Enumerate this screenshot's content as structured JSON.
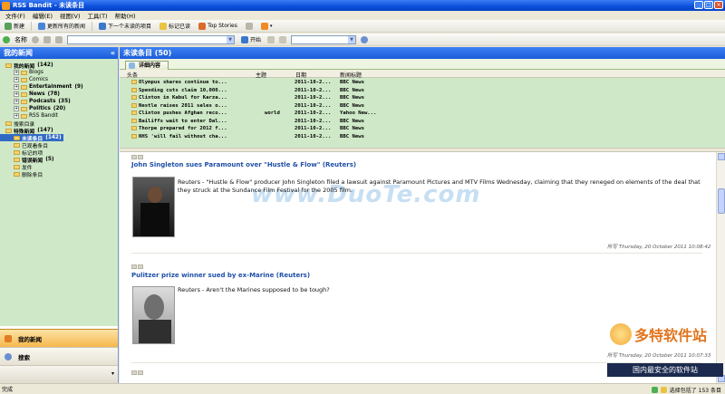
{
  "window": {
    "title": "RSS Bandit - 未读条目"
  },
  "menu": [
    "文件(F)",
    "编辑(E)",
    "视图(V)",
    "工具(T)",
    "帮助(H)"
  ],
  "toolbar1": {
    "new": "新建",
    "refresh_all": "更新所有的新闻",
    "next_unread": "下一个未读的项目",
    "mark_read": "标记已读",
    "top_stories": "Top Stories"
  },
  "toolbar2": {
    "name": "名称",
    "start": "开始"
  },
  "left_pane": {
    "title": "我的新闻",
    "tree": [
      {
        "label": "我的新闻",
        "count": "(142)",
        "bold": true,
        "indent": 1
      },
      {
        "label": "Blogs",
        "count": "",
        "bold": false,
        "indent": 2
      },
      {
        "label": "Comics",
        "count": "",
        "bold": false,
        "indent": 2
      },
      {
        "label": "Entertainment",
        "count": "(9)",
        "bold": true,
        "indent": 2
      },
      {
        "label": "News",
        "count": "(78)",
        "bold": true,
        "indent": 2
      },
      {
        "label": "Podcasts",
        "count": "(35)",
        "bold": true,
        "indent": 2
      },
      {
        "label": "Politics",
        "count": "(20)",
        "bold": true,
        "indent": 2
      },
      {
        "label": "RSS Bandit",
        "count": "",
        "bold": false,
        "indent": 2
      },
      {
        "label": "搜索目录",
        "count": "",
        "bold": false,
        "indent": 1
      },
      {
        "label": "特殊新闻",
        "count": "(147)",
        "bold": true,
        "indent": 1
      },
      {
        "label": "未读条目",
        "count": "(142)",
        "bold": true,
        "indent": 2,
        "selected": true
      },
      {
        "label": "已观看条目",
        "count": "",
        "bold": false,
        "indent": 2
      },
      {
        "label": "标记的项",
        "count": "",
        "bold": false,
        "indent": 2
      },
      {
        "label": "错误新闻",
        "count": "(5)",
        "bold": true,
        "indent": 2
      },
      {
        "label": "发件",
        "count": "",
        "bold": false,
        "indent": 2
      },
      {
        "label": "删除条目",
        "count": "",
        "bold": false,
        "indent": 2
      }
    ],
    "nav_active": "我的新闻",
    "nav_other": "搜索"
  },
  "right_pane": {
    "title": "未读条目 (50)",
    "tab": "详细内容",
    "columns": {
      "headline": "头条",
      "subject": "主题",
      "date": "日期",
      "feed": "新闻标题"
    },
    "rows": [
      {
        "headline": "Olympus shares continue to...",
        "subject": "",
        "date": "2011-10-2...",
        "feed": "BBC News"
      },
      {
        "headline": "Spending cuts claim 10,000...",
        "subject": "",
        "date": "2011-10-2...",
        "feed": "BBC News"
      },
      {
        "headline": "Clinton in Kabul for Karza...",
        "subject": "",
        "date": "2011-10-2...",
        "feed": "BBC News"
      },
      {
        "headline": "Nestle raises 2011 sales o...",
        "subject": "",
        "date": "2011-10-2...",
        "feed": "BBC News"
      },
      {
        "headline": "Clinton pushes Afghan reco...",
        "subject": "world",
        "date": "2011-10-2...",
        "feed": "Yahoo New..."
      },
      {
        "headline": "Bailiffs wait to enter Dal...",
        "subject": "",
        "date": "2011-10-2...",
        "feed": "BBC News"
      },
      {
        "headline": "Thorpe prepared for 2012 f...",
        "subject": "",
        "date": "2011-10-2...",
        "feed": "BBC News"
      },
      {
        "headline": "NHS 'will fail without cha...",
        "subject": "",
        "date": "2011-10-2...",
        "feed": "BBC News"
      }
    ],
    "articles": [
      {
        "title": "John Singleton sues Paramount over \"Hustle & Flow\" (Reuters)",
        "body": "Reuters - \"Hustle & Flow\" producer John Singleton filed a lawsuit against Paramount Pictures and MTV Films Wednesday, claiming that they reneged on elements of the deal that they struck at the Sundance Film Festival for the 2005 film.",
        "footer": "所写 Thursday, 20 October 2011 10:08:42"
      },
      {
        "title": "Pulitzer prize winner sued by ex-Marine (Reuters)",
        "body": "Reuters - Aren't the Marines supposed to be tough?",
        "footer": "所写 Thursday, 20 October 2011 10:07:33"
      }
    ],
    "watermark": "www.DuoTe.com"
  },
  "status": {
    "left": "完成",
    "right": "选择包括了 153 条目"
  },
  "logo": {
    "brand": "多特软件站",
    "tagline": "国内最安全的软件站"
  },
  "colors": {
    "tree_bg": "#cfe9c8",
    "header_blue": "#1a5dd9",
    "link_blue": "#1f4fa8",
    "nav_active": "#f6b84d"
  }
}
